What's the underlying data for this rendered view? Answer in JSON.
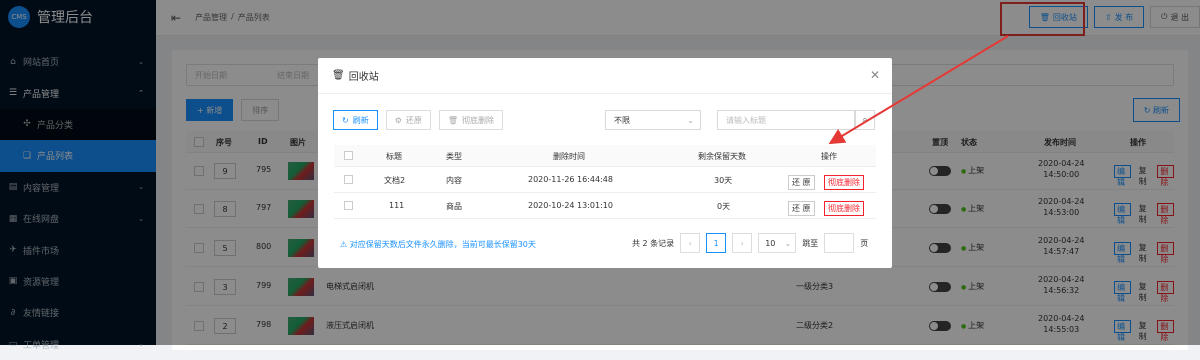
{
  "app": {
    "logo_badge": "CMS",
    "title": "管理后台"
  },
  "sidebar": {
    "items": [
      {
        "label": "网站首页",
        "icon": "home-icon"
      },
      {
        "label": "产品管理",
        "icon": "product-icon"
      },
      {
        "label": "产品分类",
        "icon": "category-icon"
      },
      {
        "label": "产品列表",
        "icon": "list-icon"
      },
      {
        "label": "内容管理",
        "icon": "content-icon"
      },
      {
        "label": "在线网盘",
        "icon": "disk-icon"
      },
      {
        "label": "插件市场",
        "icon": "plugin-icon"
      },
      {
        "label": "资源管理",
        "icon": "resource-icon"
      },
      {
        "label": "友情链接",
        "icon": "link-icon"
      },
      {
        "label": "工单管理",
        "icon": "ticket-icon"
      }
    ]
  },
  "header": {
    "breadcrumb": [
      "产品管理",
      "/",
      "产品列表"
    ],
    "buttons": {
      "recycle": "回收站",
      "publish": "发 布",
      "logout": "退 出"
    }
  },
  "bg": {
    "search_placeholder_1": "开始日期",
    "search_placeholder_2": "结束日期",
    "new_btn": "新增",
    "sort_btn": "排序",
    "refresh_btn": "刷新",
    "columns": [
      "序号",
      "ID",
      "图片",
      "置顶",
      "状态",
      "发布时间",
      "操作"
    ],
    "rows": [
      {
        "seq": "9",
        "id": "795",
        "name": "",
        "cat": "",
        "status": "上架",
        "date": "2020-04-24",
        "time": "14:50:00"
      },
      {
        "seq": "8",
        "id": "797",
        "name": "",
        "cat": "",
        "status": "上架",
        "date": "2020-04-24",
        "time": "14:53:00"
      },
      {
        "seq": "5",
        "id": "800",
        "name": "",
        "cat": "",
        "status": "上架",
        "date": "2020-04-24",
        "time": "14:57:47"
      },
      {
        "seq": "3",
        "id": "799",
        "name": "电梯式启闭机",
        "cat": "一级分类3",
        "status": "上架",
        "date": "2020-04-24",
        "time": "14:56:32"
      },
      {
        "seq": "2",
        "id": "798",
        "name": "液压式启闭机",
        "cat": "二级分类2",
        "status": "上架",
        "date": "2020-04-24",
        "time": "14:55:03"
      }
    ],
    "ops": {
      "edit": "编辑",
      "copy": "复制",
      "delete": "删除"
    }
  },
  "modal": {
    "title": "回收站",
    "refresh": "刷新",
    "restore": "还原",
    "purge": "彻底删除",
    "filter_value": "不限",
    "keyword_placeholder": "请输入标题",
    "columns": [
      "标题",
      "类型",
      "删除时间",
      "剩余保留天数",
      "操作"
    ],
    "rows": [
      {
        "title": "文档2",
        "type": "内容",
        "deleted": "2020-11-26 16:44:48",
        "days": "30天",
        "restore": "还 原",
        "purge": "彻底删除"
      },
      {
        "title": "111",
        "type": "商品",
        "deleted": "2020-10-24 13:01:10",
        "days": "0天",
        "restore": "还 原",
        "purge": "彻底删除"
      }
    ],
    "tip": "对应保留天数后文件永久删除，当前可最长保留30天",
    "pager": {
      "total": "共 2 条记录",
      "page": "1",
      "size": "10",
      "jump": "跳至",
      "unit": "页"
    }
  },
  "colors": {
    "accent": "#1890ff",
    "danger": "#f5222d",
    "sidebar": "#001529",
    "highlight": "#e53935"
  }
}
